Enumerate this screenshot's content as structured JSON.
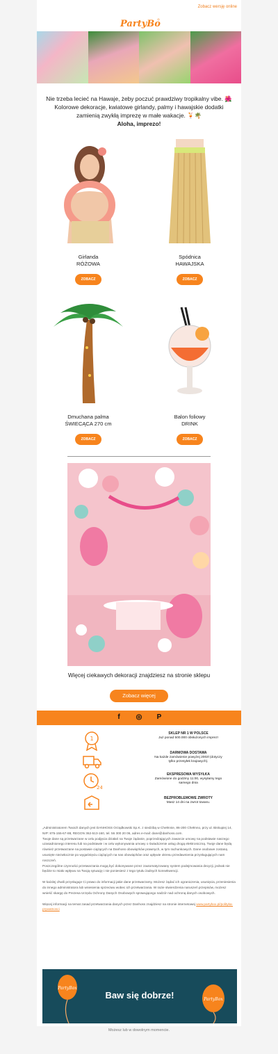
{
  "header": {
    "online_link": "Zobacz wersję online",
    "logo_text": "PartyBox"
  },
  "intro": {
    "line1": "Nie trzeba lecieć na Hawaje, żeby poczuć prawdziwy tropikalny vibe. 🌺",
    "line2": "Kolorowe dekoracje, kwiatowe girlandy, palmy i hawajskie dodatki",
    "line3": "zamienią zwykłą imprezę w małe wakacje. 🍹🌴",
    "line4": "Aloha, imprezo!"
  },
  "products": [
    {
      "name1": "Girlanda",
      "name2": "RÓŻOWA",
      "button": "ZOBACZ"
    },
    {
      "name1": "Spódnica",
      "name2": "HAWAJSKA",
      "button": "ZOBACZ"
    },
    {
      "name1": "Dmuchana palma",
      "name2": "ŚWIECĄCA 270 cm",
      "button": "ZOBACZ"
    },
    {
      "name1": "Balon foliowy",
      "name2": "DRINK",
      "button": "ZOBACZ"
    }
  ],
  "more": {
    "text": "Więcej ciekawych dekoracji znajdziesz na stronie sklepu",
    "button": "Zobacz więcej"
  },
  "social": {
    "facebook": "f",
    "instagram": "◎",
    "pinterest": "P"
  },
  "features": [
    {
      "title": "SKLEP NR 1 W POLSCE",
      "desc": "Już ponad 500.000 obsłużonych imprez!",
      "icon": "medal-icon"
    },
    {
      "title": "DARMOWA DOSTAWA",
      "desc": "Na każde zamówienie powyżej 200zł (dotyczy tylko przesyłek krajowych).",
      "icon": "truck-icon"
    },
    {
      "title": "EKSPRESOWA WYSYŁKA",
      "desc": "Zamówione do godziny 11:00, wysyłamy tego samego dnia",
      "icon": "clock-24-icon"
    },
    {
      "title": "BEZPROBLEMOWE ZWROTY",
      "desc": "Masz 14 dni na zwrot towaru.",
      "icon": "return-box-icon"
    }
  ],
  "legal": {
    "p1": "„Administratorem Twoich danych jest DANHOSS Orządkowski Sp.K. z siedzibą w Chełmnie, 86-200 Chełmno, przy ul. Biskupiej 14, NIP: 875-155-67-88, REGON 362-513-160, tel. 56 300 20 06, adres e-mail: dane@danhoss.com.",
    "p2": "Twoje dane są przetwarzane w celu podjęcia działań na Twoje żądanie, poprzedzających zawarcie umowy na podstawie naszego uzasadnionego interesu lub na podstawie i w celu wykonywania umowy o świadczenie usług drogą elektroniczną. Twoje dane będą również przetwarzane na postawie ciążących na Danhoss obowiązków prawnych, w tym rachunkowych. Dane osobowe zostaną usunięte niezwłocznie po wygaśnięciu ciążących na nas obowiązków oraz upływie okresu przedawnienia przysługujących nam roszczeń.",
    "p3": "Poszczególne czynności przetwarzania mogą być dokonywane przez zautomatyzowany system podejmowania decyzji, jednak nie będzie to miało wpływu na Twoją sytuację i nie poniesiesz z tego tytułu żadnych konsekwencji.",
    "p4": "W każdej chwili przysługuje Ci prawo do informacji jakie dane przetwarzamy. Możesz żądać ich ograniczenia, usunięcia, przeniesienia do innego administratora lub wniesienia sprzeciwu wobec ich przetwarzania. W razie stwierdzenia naruszeń przepisów, możesz wnieść skargę do Prezesa Urzędu Ochrony Danych Osobowych sprawującego nadzór nad ochroną danych osobowych.",
    "p5": "Więcej informacji na temat zasad przetwarzania danych przez Danhoss znajdziesz na stronie internetowej ",
    "link": "www.partybox.pl/polityka-prywatnosci"
  },
  "banner": {
    "text": "Baw się dobrze!",
    "balloon_text": "PartyBox"
  },
  "footer": {
    "text": "Możesz lub w dowolnym momencie."
  }
}
